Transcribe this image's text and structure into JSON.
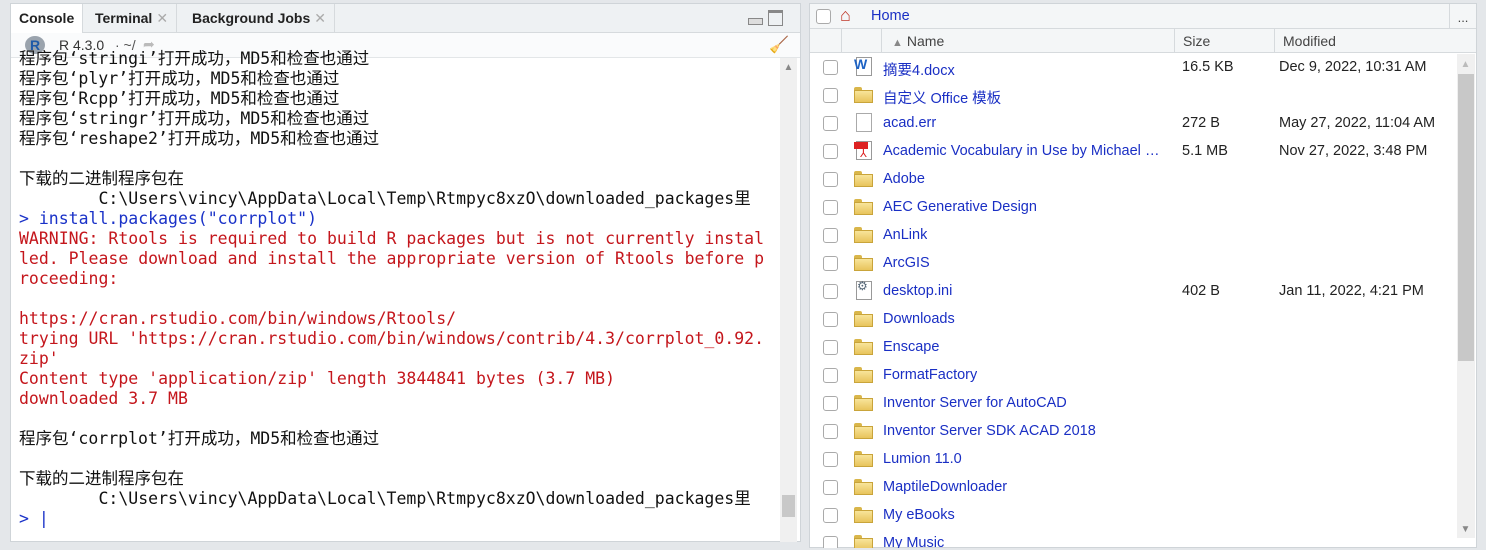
{
  "console_pane": {
    "tabs": [
      {
        "label": "Console",
        "active": true
      },
      {
        "label": "Terminal",
        "closable": true
      },
      {
        "label": "Background Jobs",
        "closable": true
      }
    ],
    "r_version": "R 4.3.0",
    "working_dir": "· ~/",
    "lines": [
      {
        "t": "out",
        "text": "程序包‘stringi’打开成功，MD5和检查也通过"
      },
      {
        "t": "out",
        "text": "程序包‘plyr’打开成功，MD5和检查也通过"
      },
      {
        "t": "out",
        "text": "程序包‘Rcpp’打开成功，MD5和检查也通过"
      },
      {
        "t": "out",
        "text": "程序包‘stringr’打开成功，MD5和检查也通过"
      },
      {
        "t": "out",
        "text": "程序包‘reshape2’打开成功，MD5和检查也通过"
      },
      {
        "t": "out",
        "text": ""
      },
      {
        "t": "out",
        "text": "下载的二进制程序包在"
      },
      {
        "t": "out",
        "text": "        C:\\Users\\vincy\\AppData\\Local\\Temp\\Rtmpyc8xzO\\downloaded_packages里"
      },
      {
        "t": "cmd",
        "text": "> install.packages(\"corrplot\")"
      },
      {
        "t": "err",
        "text": "WARNING: Rtools is required to build R packages but is not currently instal"
      },
      {
        "t": "err",
        "text": "led. Please download and install the appropriate version of Rtools before p"
      },
      {
        "t": "err",
        "text": "roceeding:"
      },
      {
        "t": "err",
        "text": ""
      },
      {
        "t": "err",
        "text": "https://cran.rstudio.com/bin/windows/Rtools/"
      },
      {
        "t": "err",
        "text": "trying URL 'https://cran.rstudio.com/bin/windows/contrib/4.3/corrplot_0.92."
      },
      {
        "t": "err",
        "text": "zip'"
      },
      {
        "t": "err",
        "text": "Content type 'application/zip' length 3844841 bytes (3.7 MB)"
      },
      {
        "t": "err",
        "text": "downloaded 3.7 MB"
      },
      {
        "t": "out",
        "text": ""
      },
      {
        "t": "out",
        "text": "程序包‘corrplot’打开成功，MD5和检查也通过"
      },
      {
        "t": "out",
        "text": ""
      },
      {
        "t": "out",
        "text": "下载的二进制程序包在"
      },
      {
        "t": "out",
        "text": "        C:\\Users\\vincy\\AppData\\Local\\Temp\\Rtmpyc8xzO\\downloaded_packages里"
      },
      {
        "t": "cmd",
        "text": "> |"
      }
    ]
  },
  "files_pane": {
    "breadcrumb": "Home",
    "more_label": "...",
    "columns": {
      "name": "Name",
      "size": "Size",
      "modified": "Modified"
    },
    "sort_icon": "triangle-up",
    "files": [
      {
        "name": "摘要4.docx",
        "type": "word",
        "size": "16.5 KB",
        "modified": "Dec 9, 2022, 10:31 AM"
      },
      {
        "name": "自定义 Office 模板",
        "type": "folder",
        "size": "",
        "modified": ""
      },
      {
        "name": "acad.err",
        "type": "file",
        "size": "272 B",
        "modified": "May 27, 2022, 11:04 AM"
      },
      {
        "name": "Academic Vocabulary in Use by Michael McCarthy.pdf",
        "type": "pdf",
        "size": "5.1 MB",
        "modified": "Nov 27, 2022, 3:48 PM"
      },
      {
        "name": "Adobe",
        "type": "folder",
        "size": "",
        "modified": ""
      },
      {
        "name": "AEC Generative Design",
        "type": "folder",
        "size": "",
        "modified": ""
      },
      {
        "name": "AnLink",
        "type": "folder",
        "size": "",
        "modified": ""
      },
      {
        "name": "ArcGIS",
        "type": "folder",
        "size": "",
        "modified": ""
      },
      {
        "name": "desktop.ini",
        "type": "settings",
        "size": "402 B",
        "modified": "Jan 11, 2022, 4:21 PM"
      },
      {
        "name": "Downloads",
        "type": "folder",
        "size": "",
        "modified": ""
      },
      {
        "name": "Enscape",
        "type": "folder",
        "size": "",
        "modified": ""
      },
      {
        "name": "FormatFactory",
        "type": "folder",
        "size": "",
        "modified": ""
      },
      {
        "name": "Inventor Server for AutoCAD",
        "type": "folder",
        "size": "",
        "modified": ""
      },
      {
        "name": "Inventor Server SDK ACAD 2018",
        "type": "folder",
        "size": "",
        "modified": ""
      },
      {
        "name": "Lumion 11.0",
        "type": "folder",
        "size": "",
        "modified": ""
      },
      {
        "name": "MaptileDownloader",
        "type": "folder",
        "size": "",
        "modified": ""
      },
      {
        "name": "My eBooks",
        "type": "folder",
        "size": "",
        "modified": ""
      },
      {
        "name": "My Music",
        "type": "folder",
        "size": "",
        "modified": ""
      }
    ]
  },
  "colors": {
    "command": "#1a32c8",
    "error": "#c4161c",
    "link": "#1a2fc4"
  }
}
